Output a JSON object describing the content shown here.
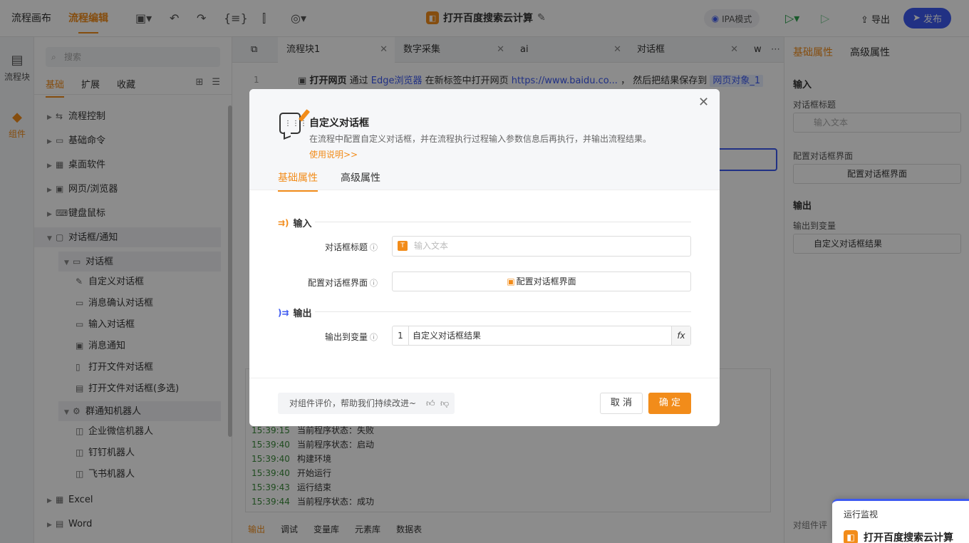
{
  "topbar": {
    "tabs": [
      "流程画布",
      "流程编辑"
    ],
    "title": "打开百度搜索云计算",
    "mode": "IPA模式",
    "export": "导出",
    "publish": "发布"
  },
  "leftrail": {
    "items": [
      "流程块",
      "组件"
    ]
  },
  "sidebar": {
    "search_placeholder": "搜索",
    "tabs": [
      "基础",
      "扩展",
      "收藏"
    ],
    "tree": [
      "流程控制",
      "基础命令",
      "桌面软件",
      "网页/浏览器",
      "键盘鼠标",
      "对话框/通知",
      "对话框",
      "自定义对话框",
      "消息确认对话框",
      "输入对话框",
      "消息通知",
      "打开文件对话框",
      "打开文件对话框(多选)",
      "群通知机器人",
      "企业微信机器人",
      "钉钉机器人",
      "飞书机器人",
      "Excel",
      "Word"
    ]
  },
  "editor": {
    "tabs": [
      "流程块1",
      "数字采集",
      "ai",
      "对话框",
      "w"
    ],
    "line1": {
      "num": "1",
      "action": "打开网页",
      "via": "通过",
      "browser": "Edge浏览器",
      "mid": "在新标签中打开网页",
      "url": "https://www.baidu.co...",
      "tail": "，  然后把结果保存到",
      "var": "网页对象_1"
    },
    "logs": [
      {
        "time": "15:39:15",
        "msg": "当前程序状态：失败"
      },
      {
        "time": "15:39:40",
        "msg": "当前程序状态：启动"
      },
      {
        "time": "15:39:40",
        "msg": "构建环境"
      },
      {
        "time": "15:39:40",
        "msg": "开始运行"
      },
      {
        "time": "15:39:43",
        "msg": "运行结束"
      },
      {
        "time": "15:39:44",
        "msg": "当前程序状态：成功"
      }
    ],
    "bottom_tabs": [
      "输出",
      "调试",
      "变量库",
      "元素库",
      "数据表"
    ]
  },
  "rightpanel": {
    "tabs": [
      "基础属性",
      "高级属性"
    ],
    "input_section": "输入",
    "title_label": "对话框标题",
    "title_placeholder": "输入文本",
    "config_label": "配置对话框界面",
    "config_button": "配置对话框界面",
    "output_section": "输出",
    "output_label": "输出到变量",
    "output_num": "1",
    "output_value": "自定义对话框结果",
    "feedback_cut": "对组件评"
  },
  "modal": {
    "title": "自定义对话框",
    "desc": "在流程中配置自定义对话框，并在流程执行过程输入参数信息后再执行，并输出流程结果。",
    "link": "使用说明>>",
    "tabs": [
      "基础属性",
      "高级属性"
    ],
    "input_section": "输入",
    "title_label": "对话框标题",
    "title_placeholder": "输入文本",
    "config_label": "配置对话框界面",
    "config_button": "配置对话框界面",
    "output_section": "输出",
    "output_label": "输出到变量",
    "output_num": "1",
    "output_value": "自定义对话框结果",
    "fx": "fx",
    "feedback": "对组件评价，帮助我们持续改进~",
    "cancel": "取 消",
    "ok": "确 定"
  },
  "run_monitor": {
    "label": "运行监视",
    "title": "打开百度搜索云计算"
  },
  "colors": {
    "accent": "#f28c1a",
    "primary": "#3d5af1"
  }
}
